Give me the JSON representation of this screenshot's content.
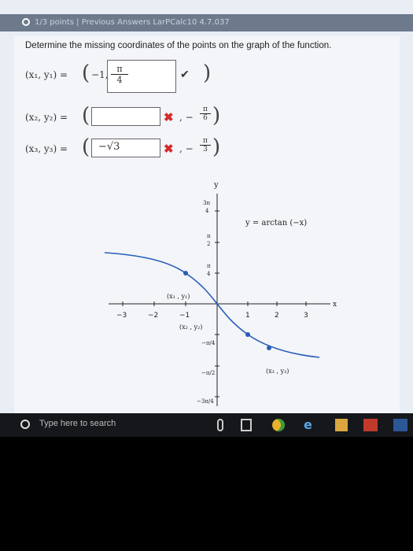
{
  "header": {
    "text": "1/3 points  |  Previous Answers  LarPCalc10 4.7.037"
  },
  "question": "Determine the missing coordinates of the points on the graph of the function.",
  "rows": [
    {
      "label": "(x₁, y₁)  =",
      "prefix": "−1,",
      "answer": "",
      "frac_num": "π",
      "frac_den": "4",
      "status": "✔"
    },
    {
      "label": "(x₂, y₂)  =",
      "answer": "",
      "status": "✖",
      "suffix_prefix": ", −",
      "suffix_num": "π",
      "suffix_den": "6"
    },
    {
      "label": "(x₃, y₃)  =",
      "answer": "−√3",
      "status": "✖",
      "suffix_prefix": ", −",
      "suffix_num": "π",
      "suffix_den": "3"
    }
  ],
  "graph": {
    "ylabel": "y",
    "xlabel": "x",
    "function_label": "y = arctan (−x)",
    "x_ticks": [
      "−3",
      "−2",
      "−1",
      "1",
      "2",
      "3"
    ],
    "y_tick_3pi4_num": "3π",
    "y_tick_3pi4_den": "4",
    "y_tick_pi2_num": "π",
    "y_tick_pi2_den": "2",
    "y_tick_pi4_num": "π",
    "y_tick_pi4_den": "4",
    "y_tick_mpi4": "−π/4",
    "y_tick_mpi2": "−π/2",
    "y_tick_m3pi4": "−3π/4",
    "point_labels": [
      "(x₁ , y₁)",
      "(x₂ , y₂)",
      "(x₃ , y₃)"
    ]
  },
  "taskbar": {
    "search_placeholder": "Type here to search"
  }
}
